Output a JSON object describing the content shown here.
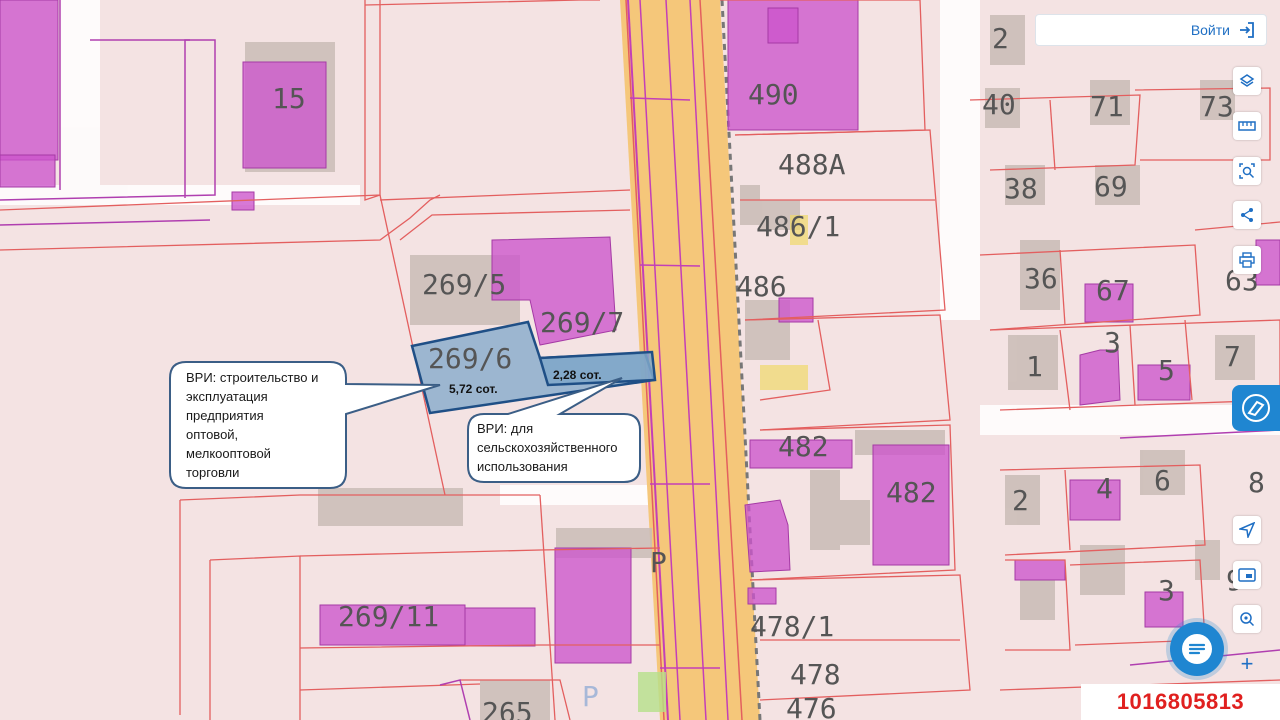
{
  "map": {
    "parcel_labels": {
      "l15": "15",
      "l490": "490",
      "l488a": "488А",
      "l486_1": "486/1",
      "l486": "486",
      "l482a": "482",
      "l482b": "482",
      "l478_1": "478/1",
      "l478": "478",
      "l476": "476",
      "l269_5": "269/5",
      "l269_7": "269/7",
      "l269_6": "269/6",
      "l269_11": "269/11",
      "l265": "265",
      "l2a": "2",
      "l40": "40",
      "l71": "71",
      "l73": "73",
      "l38": "38",
      "l69": "69",
      "l36": "36",
      "l67": "67",
      "l63": "63",
      "l1": "1",
      "l3a": "3",
      "l5": "5",
      "l7": "7",
      "l2b": "2",
      "l4": "4",
      "l6": "6",
      "l8": "8",
      "l3b": "3",
      "l9": "9",
      "lP1": "P",
      "lP2": "P"
    },
    "colors": {
      "background": "#f4e3e3",
      "boundary": "#e35f5f",
      "building_fill": "#cc55cc",
      "road_fill": "#f5c77a",
      "selected_fill": "#7fa7c9",
      "selected_stroke": "#1f4f86",
      "accent": "#1f86d1",
      "listing_id": "#e0201f"
    }
  },
  "callouts": {
    "left_text": "ВРИ: строительство и\nэксплуатация\nпредприятия\nоптовой,\nмелкооптовой\nторговли",
    "right_text": "ВРИ: для\nсельскохозяйственного\nиспользования",
    "area_left": "5,72 сот.",
    "area_right": "2,28 сот."
  },
  "controls": {
    "login_label": "Войти",
    "tool_icons": [
      "layers-icon",
      "ruler-icon",
      "area-search-icon",
      "share-icon",
      "print-icon",
      "navigate-icon",
      "screenshot-icon",
      "locate-icon"
    ],
    "plus_label": "+"
  },
  "listing_id": "1016805813"
}
